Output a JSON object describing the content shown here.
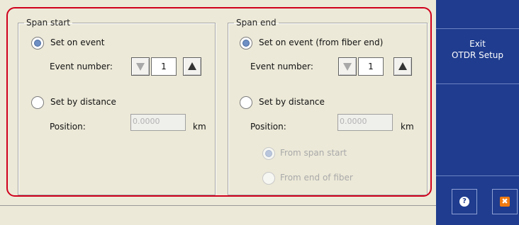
{
  "span_start": {
    "legend": "Span start",
    "set_on_event_label": "Set on event",
    "event_number_label": "Event number:",
    "event_number_value": "1",
    "set_by_distance_label": "Set by distance",
    "position_label": "Position:",
    "position_value": "0.0000",
    "position_unit": "km"
  },
  "span_end": {
    "legend": "Span end",
    "set_on_event_label": "Set on event (from fiber end)",
    "event_number_label": "Event number:",
    "event_number_value": "1",
    "set_by_distance_label": "Set by distance",
    "position_label": "Position:",
    "position_value": "0.0000",
    "position_unit": "km",
    "from_span_start_label": "From span start",
    "from_end_of_fiber_label": "From end of fiber"
  },
  "side_panel": {
    "exit_line1": "Exit",
    "exit_line2": "OTDR Setup",
    "help_glyph": "?",
    "close_glyph": "✖"
  },
  "colors": {
    "side_panel_bg": "#1f3c8e",
    "highlight_border": "#d0001c",
    "background": "#ece9d8"
  }
}
